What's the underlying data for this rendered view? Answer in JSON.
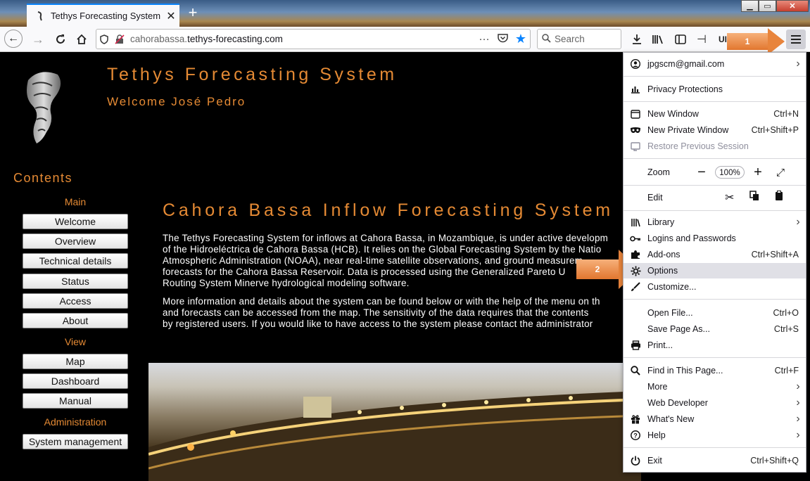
{
  "browser": {
    "tab_title": "Tethys Forecasting System",
    "url_prefix": "cahorabassa.",
    "url_domain": "tethys-forecasting.com",
    "search_placeholder": "Search",
    "toolbar_truncated_label": "UI"
  },
  "site": {
    "title": "Tethys Forecasting System",
    "welcome": "Welcome José Pedro",
    "contents_heading": "Contents",
    "sections": [
      {
        "heading": "Main",
        "buttons": [
          "Welcome",
          "Overview",
          "Technical details",
          "Status",
          "Access",
          "About"
        ]
      },
      {
        "heading": "View",
        "buttons": [
          "Map",
          "Dashboard",
          "Manual"
        ]
      },
      {
        "heading": "Administration",
        "buttons": [
          "System management"
        ]
      }
    ],
    "main_title": "Cahora Bassa Inflow Forecasting System",
    "paragraph1": [
      "The Tethys Forecasting System for inflows at Cahora Bassa, in Mozambique, is under active developm",
      "of the Hidroeléctrica de Cahora Bassa (HCB). It relies on the Global Forecasting System by the Natio",
      "Atmospheric Administration (NOAA), near real-time satellite observations, and ground measurem",
      "forecasts for the Cahora Bassa Reservoir. Data is processed using the Generalized Pareto U",
      "Routing System Minerve hydrological modeling software."
    ],
    "paragraph2": [
      "More information and details about the system can be found below or with the help of the menu on th",
      "and forecasts can be accessed from the map. The sensitivity of the data requires that the contents",
      "by registered users. If you would like to have access to the system please contact the administrator"
    ]
  },
  "annotations": {
    "arrow1": "1",
    "arrow2": "2",
    "color": "#e8843c"
  },
  "menu": {
    "account": "jpgscm@gmail.com",
    "privacy": "Privacy Protections",
    "new_window": {
      "label": "New Window",
      "shortcut": "Ctrl+N"
    },
    "private_window": {
      "label": "New Private Window",
      "shortcut": "Ctrl+Shift+P"
    },
    "restore": "Restore Previous Session",
    "zoom": {
      "label": "Zoom",
      "value": "100%"
    },
    "edit": "Edit",
    "library": "Library",
    "logins": "Logins and Passwords",
    "addons": {
      "label": "Add-ons",
      "shortcut": "Ctrl+Shift+A"
    },
    "options": "Options",
    "customize": "Customize...",
    "open_file": {
      "label": "Open File...",
      "shortcut": "Ctrl+O"
    },
    "save_page": {
      "label": "Save Page As...",
      "shortcut": "Ctrl+S"
    },
    "print": "Print...",
    "find": {
      "label": "Find in This Page...",
      "shortcut": "Ctrl+F"
    },
    "more": "More",
    "web_dev": "Web Developer",
    "whats_new": "What's New",
    "help": "Help",
    "exit": {
      "label": "Exit",
      "shortcut": "Ctrl+Shift+Q"
    }
  }
}
